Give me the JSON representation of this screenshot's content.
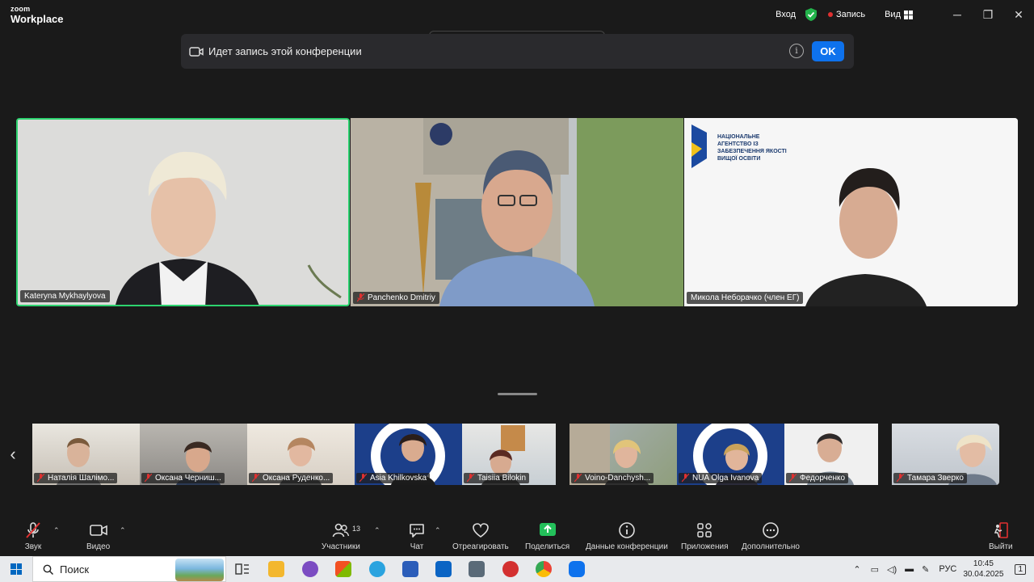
{
  "app": {
    "logo_top": "zoom",
    "logo_bottom": "Workplace"
  },
  "titlebar": {
    "login": "Вход",
    "recording": "Запись",
    "view": "Вид",
    "minimize": "─",
    "maximize": "❐",
    "close": "✕"
  },
  "notification": {
    "message": "Идет запись этой конференции",
    "info_icon": "i",
    "ok": "OK"
  },
  "main_tiles": [
    {
      "name": "Kateryna Mykhaylyova",
      "muted": false,
      "active_speaker": true
    },
    {
      "name": "Panchenko Dmitriy",
      "muted": true
    },
    {
      "name": "Микола Неборачко (член ЕГ)",
      "muted": false,
      "logo_text": "НАЦІОНАЛЬНЕ АГЕНТСТВО ІЗ ЗАБЕЗПЕЧЕННЯ ЯКОСТІ ВИЩОЇ ОСВІТИ"
    }
  ],
  "strip": {
    "prev": "‹",
    "participants": [
      {
        "name": "Наталія Шалімо..."
      },
      {
        "name": "Оксана Черниш..."
      },
      {
        "name": "Оксана Руденко..."
      },
      {
        "name": "Asia Khilkovska"
      },
      {
        "name": "Taisiia Bilokin"
      },
      {
        "name": "Voino-Danchysh..."
      },
      {
        "name": "NUA Olga Ivanova"
      },
      {
        "name": "Федорченко"
      },
      {
        "name": "Тамара Зверко"
      }
    ]
  },
  "toolbar": {
    "audio": "Звук",
    "video": "Видео",
    "participants": "Участники",
    "participants_count": "13",
    "chat": "Чат",
    "react": "Отреагировать",
    "share": "Поделиться",
    "meeting_info": "Данные конференции",
    "apps": "Приложения",
    "more": "Дополнительно",
    "leave": "Выйти"
  },
  "taskbar": {
    "search_placeholder": "Поиск",
    "language": "РУС",
    "time": "10:45",
    "date": "30.04.2025",
    "notification_count": "1"
  },
  "colors": {
    "zoom_blue": "#0e72ed",
    "active_speaker": "#2dd36f",
    "recording_red": "#e03030"
  }
}
